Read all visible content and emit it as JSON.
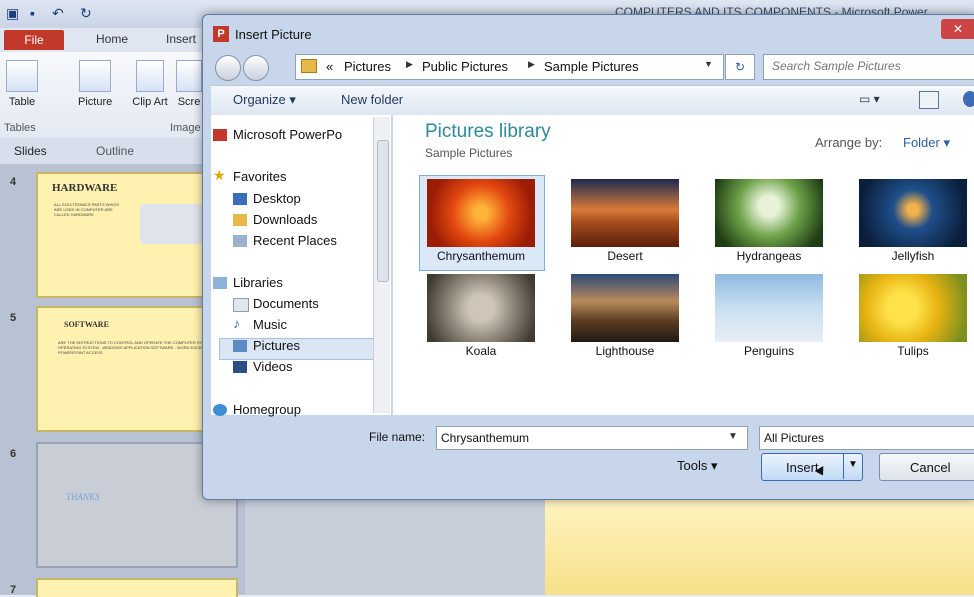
{
  "powerpoint": {
    "window_title": "COMPUTERS AND ITS COMPONENTS - Microsoft Power",
    "tabs": [
      "File",
      "Home",
      "Insert"
    ],
    "ribbon_buttons": [
      "Table",
      "Picture",
      "Clip Art",
      "Scre"
    ],
    "groups": [
      "Tables",
      "Image"
    ],
    "pane_tabs": [
      "Slides",
      "Outline"
    ],
    "slides": [
      {
        "num": "4",
        "title": "HARDWARE",
        "body": "ALL ELECTRONICS PARTS WHICH ARE USED IN COMPUTER ARE CALLED HARDWARE"
      },
      {
        "num": "5",
        "title": "SOFTWARE",
        "body": "ARE THE INSTRUCTIONS TO CONTROL AND OPERATE THE COMPUTER SYSTEM OPERATING SYSTEM - WINDOWS APPLICATION SOFTWARE - WORD EXCEL POWERPOINT ACCESS"
      },
      {
        "num": "6",
        "title": "THANKS",
        "body": ""
      },
      {
        "num": "7",
        "title": "",
        "body": ""
      }
    ]
  },
  "dialog": {
    "title": "Insert Picture",
    "breadcrumb": [
      "«",
      "Pictures",
      "Public Pictures",
      "Sample Pictures"
    ],
    "search_placeholder": "Search Sample Pictures",
    "toolbar": {
      "organize": "Organize ▾",
      "new_folder": "New folder"
    },
    "nav": {
      "top_item": "Microsoft PowerPo",
      "favorites": "Favorites",
      "favorites_items": [
        "Desktop",
        "Downloads",
        "Recent Places"
      ],
      "libraries": "Libraries",
      "libraries_items": [
        "Documents",
        "Music",
        "Pictures",
        "Videos"
      ],
      "homegroup": "Homegroup"
    },
    "library_title": "Pictures library",
    "library_sub": "Sample Pictures",
    "arrange_label": "Arrange by:",
    "arrange_value": "Folder ▾",
    "pictures": [
      "Chrysanthemum",
      "Desert",
      "Hydrangeas",
      "Jellyfish",
      "Koala",
      "Lighthouse",
      "Penguins",
      "Tulips"
    ],
    "selected_picture": "Chrysanthemum",
    "file_name_label": "File name:",
    "file_name_value": "Chrysanthemum",
    "file_type": "All Pictures",
    "tools": "Tools ▾",
    "insert": "Insert",
    "cancel": "Cancel"
  }
}
